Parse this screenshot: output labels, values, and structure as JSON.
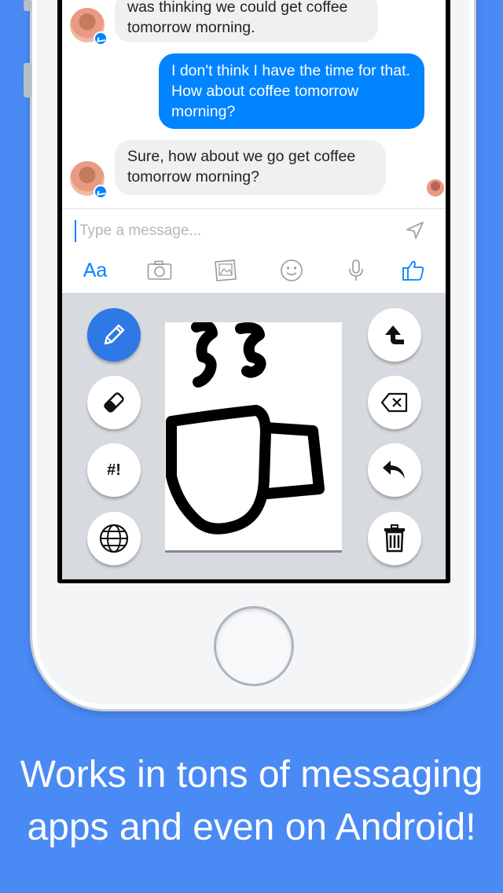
{
  "conversation": {
    "messages": [
      {
        "from": "other",
        "text_line1": "was thinking we could get coffee",
        "text_line2": "tomorrow morning."
      },
      {
        "from": "me",
        "text": "I don't think I have the time for that. How about coffee tomorrow morning?"
      },
      {
        "from": "other",
        "text": "Sure, how about we go get coffee tomorrow morning?"
      }
    ]
  },
  "composer": {
    "placeholder": "Type a message...",
    "aa_label": "Aa"
  },
  "keyboard": {
    "symbols_label": "#!",
    "active_tool": "pencil"
  },
  "caption": {
    "line1": "Works in tons of messaging",
    "line2": "apps and even on Android!"
  },
  "colors": {
    "background": "#4a8af4",
    "accent": "#0084ff",
    "active_button": "#2f79e6"
  }
}
